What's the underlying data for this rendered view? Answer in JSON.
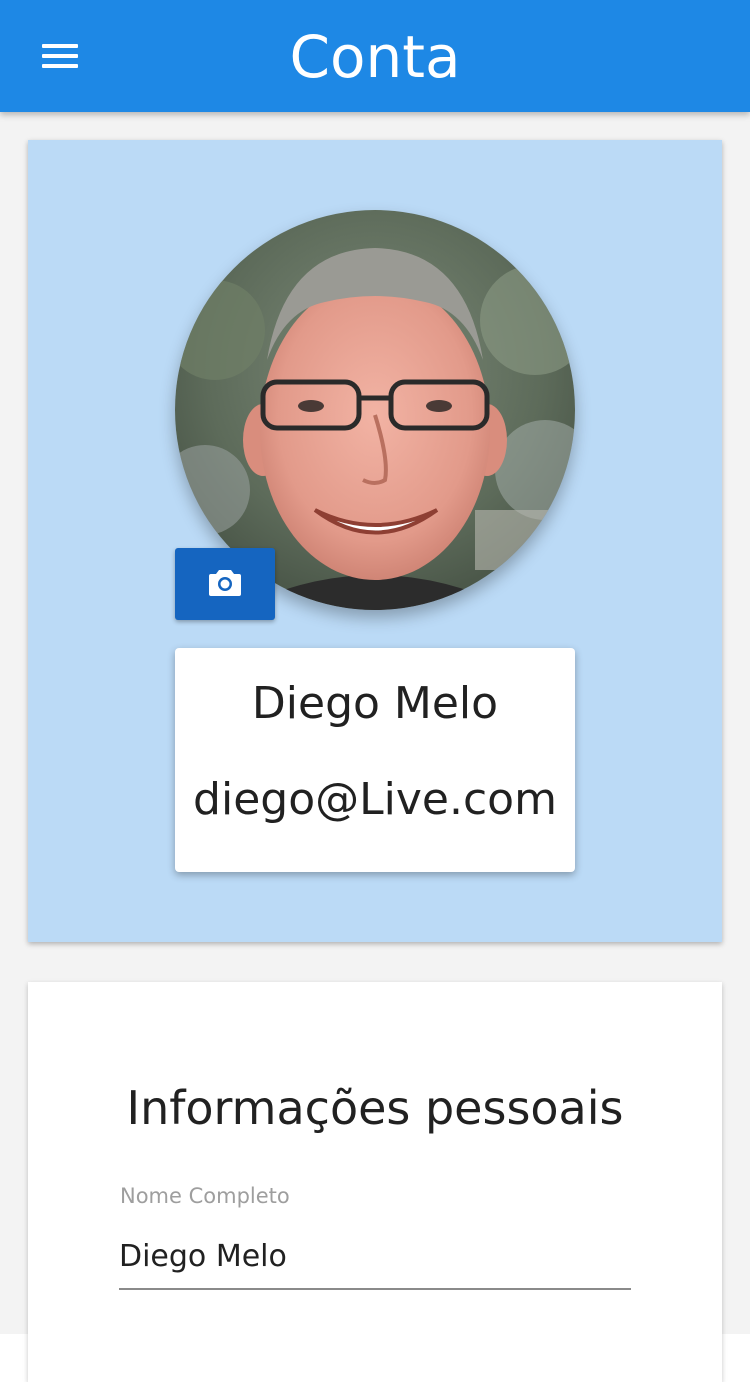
{
  "appbar": {
    "title": "Conta",
    "menu_icon": "hamburger-menu-icon",
    "color": "#1e88e5"
  },
  "profile": {
    "avatar_alt": "profile-photo",
    "camera_icon": "camera-icon",
    "name": "Diego Melo",
    "email": "diego@Live.com",
    "card_color": "#bbdaf6",
    "button_color": "#1565c0"
  },
  "personal_info": {
    "title": "Informações pessoais",
    "fields": [
      {
        "label": "Nome Completo",
        "value": "Diego Melo"
      }
    ]
  }
}
